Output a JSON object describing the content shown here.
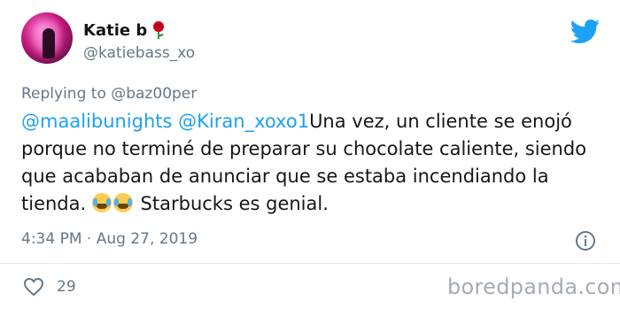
{
  "tweet": {
    "author": {
      "display_name": "Katie b",
      "handle": "@katiebass_xo"
    },
    "replying_to": {
      "prefix": "Replying to ",
      "handle": "@baz00per"
    },
    "mentions": [
      "@maalibunights",
      "@Kiran_xoxo1"
    ],
    "text_line1": "Una vez, un cliente se",
    "text_rest": "enojó porque no terminé de preparar su chocolate caliente, siendo que acababan de anunciar que se estaba incendiando la tienda.",
    "text_end": "Starbucks es genial.",
    "emojis": [
      "face-with-tears-of-joy",
      "face-with-tears-of-joy"
    ],
    "timestamp": "4:34 PM · Aug 27, 2019",
    "like_count": "29"
  },
  "watermark": "boredpanda.com",
  "colors": {
    "link": "#1da1f2",
    "secondary_text": "#657786",
    "twitter_blue": "#1da1f2"
  },
  "icons": [
    "rose-emoji-icon",
    "twitter-bird-icon",
    "info-icon",
    "heart-icon"
  ]
}
